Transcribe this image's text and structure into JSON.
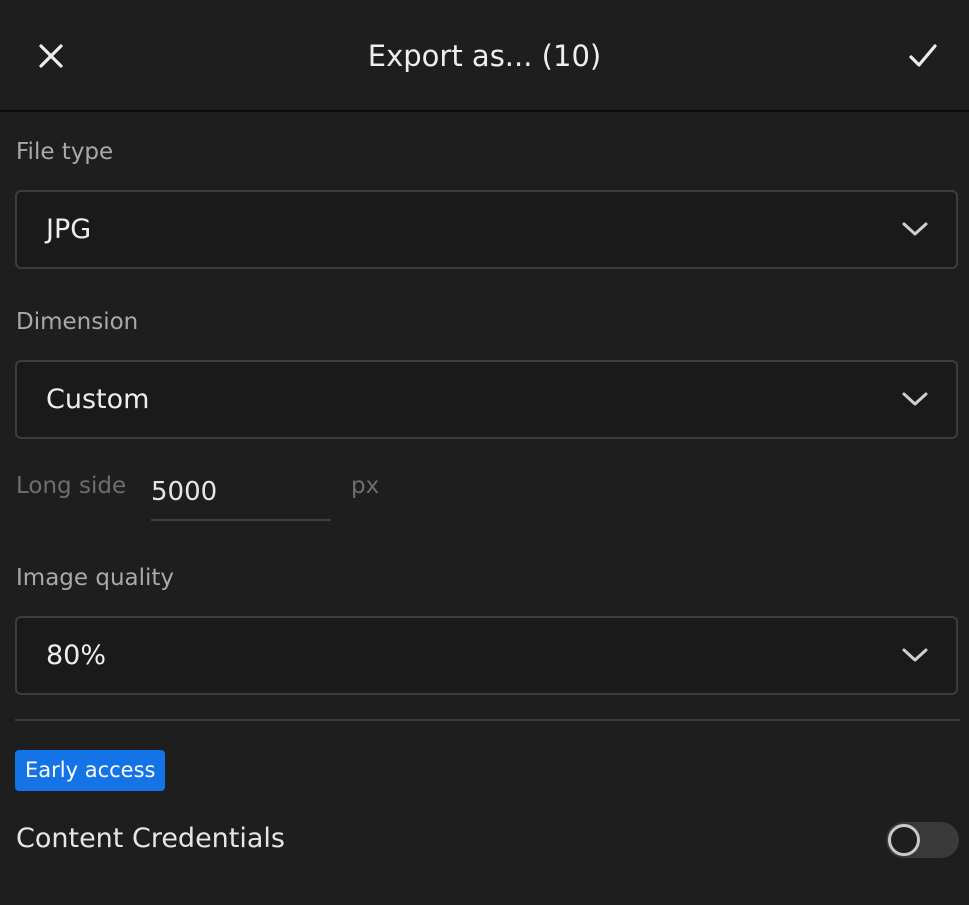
{
  "header": {
    "title": "Export as... (10)",
    "close_icon": "close-icon",
    "confirm_icon": "checkmark-icon"
  },
  "file_type": {
    "label": "File type",
    "value": "JPG"
  },
  "dimension": {
    "label": "Dimension",
    "value": "Custom",
    "long_side_label": "Long side",
    "long_side_value": "5000",
    "unit": "px"
  },
  "image_quality": {
    "label": "Image quality",
    "value": "80%"
  },
  "early_access": {
    "badge": "Early access",
    "badge_color": "#1473e6"
  },
  "content_credentials": {
    "label": "Content Credentials",
    "enabled": false
  },
  "colors": {
    "background": "#1e1e1e",
    "text_primary": "#efefef",
    "text_secondary": "#a9a9a9"
  }
}
